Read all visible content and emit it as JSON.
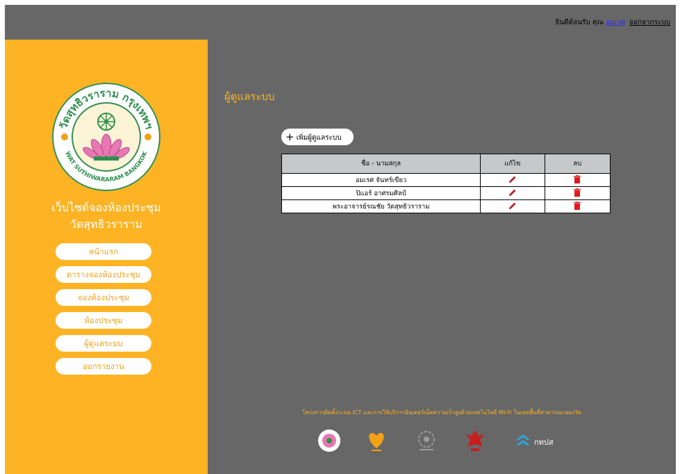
{
  "header": {
    "welcome_prefix": "ยินดีต้อนรับ คุณ",
    "user_name": "อมเรศ",
    "logout_label": "ออกจากระบบ"
  },
  "sidebar": {
    "logo_text_top": "วัดสุทธิวราราม กรุงเทพฯ",
    "logo_text_bottom": "WAT SUTHIWARARAM BANGKOK",
    "site_title_line1": "เว็บไซต์จองห้องประชุม",
    "site_title_line2": "วัดสุทธิวราราม",
    "nav": [
      {
        "label": "หน้าแรก"
      },
      {
        "label": "ตารางจองห้องประชุม"
      },
      {
        "label": "จองห้องประชุม"
      },
      {
        "label": "ห้องประชุม"
      },
      {
        "label": "ผู้ดูแลระบบ"
      },
      {
        "label": "ออกรายงาน"
      }
    ]
  },
  "main": {
    "page_title": "ผู้ดูแลระบบ",
    "add_button_label": "เพิ่มผู้ดูแลระบบ",
    "table": {
      "headers": {
        "name": "ชื่อ - นามสกุล",
        "edit": "แก้ไข",
        "delete": "ลบ"
      },
      "rows": [
        {
          "name": "อมเรศ   จันทร์เขียว"
        },
        {
          "name": "ปิแอร์   อาศรมศิลป์"
        },
        {
          "name": "พระอาจารย์รณชัย   วัดสุทธิวราราม"
        }
      ]
    },
    "footer_text": "โครงการติดตั้งระบบ ICT และการให้บริการอินเตอร์เน็ตความเร็วสูงด้วยเทคโนโลยี Wi-Fi ในเขตพื้นที่สาธารณะของวัด",
    "partner_label": "กทปส"
  },
  "colors": {
    "accent": "#fdb323",
    "panel": "#676767",
    "edit_icon": "#b5232e",
    "delete_icon": "#e01b1b"
  }
}
